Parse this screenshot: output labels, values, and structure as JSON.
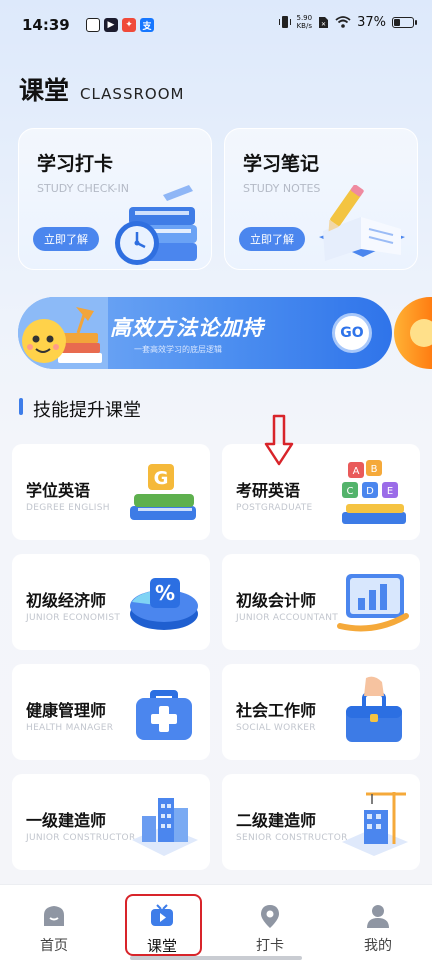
{
  "status_bar": {
    "time": "14:39",
    "net_speed_value": "5.90",
    "net_speed_unit": "KB/s",
    "battery": "37%"
  },
  "header": {
    "title": "课堂",
    "subtitle": "CLASSROOM"
  },
  "top_cards": [
    {
      "title": "学习打卡",
      "subtitle": "STUDY CHECK-IN",
      "button": "立即了解"
    },
    {
      "title": "学习笔记",
      "subtitle": "STUDY NOTES",
      "button": "立即了解"
    }
  ],
  "banner": {
    "title": "高效方法论加持",
    "subtitle": "一套高效学习的底层逻辑",
    "go_label": "GO"
  },
  "section": {
    "title": "技能提升课堂"
  },
  "courses": [
    {
      "title": "学位英语",
      "subtitle": "DEGREE ENGLISH"
    },
    {
      "title": "考研英语",
      "subtitle": "POSTGRADUATE"
    },
    {
      "title": "初级经济师",
      "subtitle": "JUNIOR ECONOMIST"
    },
    {
      "title": "初级会计师",
      "subtitle": "JUNIOR ACCOUNTANT"
    },
    {
      "title": "健康管理师",
      "subtitle": "HEALTH MANAGER"
    },
    {
      "title": "社会工作师",
      "subtitle": "SOCIAL WORKER"
    },
    {
      "title": "一级建造师",
      "subtitle": "JUNIOR CONSTRUCTOR"
    },
    {
      "title": "二级建造师",
      "subtitle": "SENIOR CONSTRUCTOR"
    }
  ],
  "bottom_nav": [
    {
      "label": "首页",
      "icon": "home-icon"
    },
    {
      "label": "课堂",
      "icon": "tv-play-icon",
      "active": true
    },
    {
      "label": "打卡",
      "icon": "location-pin-icon"
    },
    {
      "label": "我的",
      "icon": "user-icon"
    }
  ],
  "colors": {
    "accent": "#3e7de9",
    "button": "#4b86ee",
    "annotation_red": "#d8242a"
  }
}
